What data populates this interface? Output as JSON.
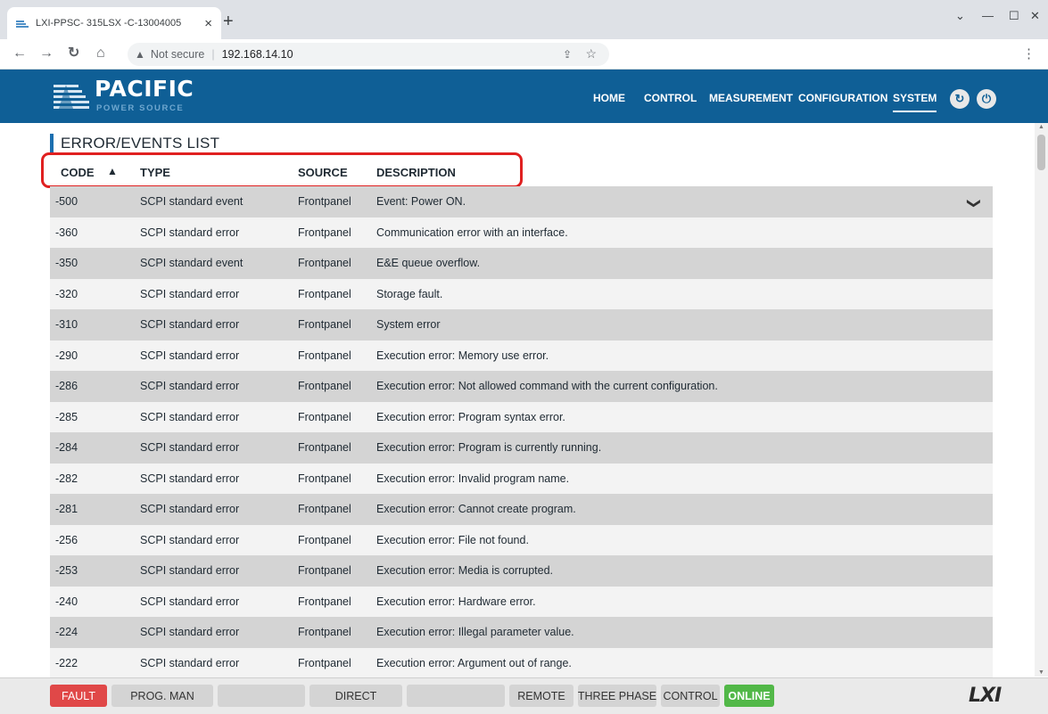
{
  "browser": {
    "tab_title": "LXI-PPSC- 315LSX -C-13004005",
    "address_security": "Not secure",
    "address_url": "192.168.14.10"
  },
  "header": {
    "brand": "PACIFIC",
    "brand_sub": "POWER SOURCE",
    "menu": [
      "HOME",
      "CONTROL",
      "MEASUREMENT",
      "CONFIGURATION",
      "SYSTEM"
    ],
    "active_menu": "SYSTEM",
    "accent_color": "#0f5f96"
  },
  "page": {
    "title": "ERROR/EVENTS LIST",
    "columns": {
      "code": "CODE",
      "type": "TYPE",
      "source": "SOURCE",
      "description": "DESCRIPTION"
    },
    "sort_column": "CODE",
    "rows": [
      {
        "code": "-500",
        "type": "SCPI standard event",
        "source": "Frontpanel",
        "description": "Event: Power ON."
      },
      {
        "code": "-360",
        "type": "SCPI standard error",
        "source": "Frontpanel",
        "description": "Communication error with an interface."
      },
      {
        "code": "-350",
        "type": "SCPI standard event",
        "source": "Frontpanel",
        "description": "E&E queue overflow."
      },
      {
        "code": "-320",
        "type": "SCPI standard error",
        "source": "Frontpanel",
        "description": "Storage fault."
      },
      {
        "code": "-310",
        "type": "SCPI standard error",
        "source": "Frontpanel",
        "description": "System error"
      },
      {
        "code": "-290",
        "type": "SCPI standard error",
        "source": "Frontpanel",
        "description": "Execution error: Memory use error."
      },
      {
        "code": "-286",
        "type": "SCPI standard error",
        "source": "Frontpanel",
        "description": "Execution error: Not allowed command with the current configuration."
      },
      {
        "code": "-285",
        "type": "SCPI standard error",
        "source": "Frontpanel",
        "description": "Execution error: Program syntax error."
      },
      {
        "code": "-284",
        "type": "SCPI standard error",
        "source": "Frontpanel",
        "description": "Execution error: Program is currently running."
      },
      {
        "code": "-282",
        "type": "SCPI standard error",
        "source": "Frontpanel",
        "description": "Execution error: Invalid program name."
      },
      {
        "code": "-281",
        "type": "SCPI standard error",
        "source": "Frontpanel",
        "description": "Execution error: Cannot create program."
      },
      {
        "code": "-256",
        "type": "SCPI standard error",
        "source": "Frontpanel",
        "description": "Execution error: File not found."
      },
      {
        "code": "-253",
        "type": "SCPI standard error",
        "source": "Frontpanel",
        "description": "Execution error: Media is corrupted."
      },
      {
        "code": "-240",
        "type": "SCPI standard error",
        "source": "Frontpanel",
        "description": "Execution error: Hardware error."
      },
      {
        "code": "-224",
        "type": "SCPI standard error",
        "source": "Frontpanel",
        "description": "Execution error: Illegal parameter value."
      },
      {
        "code": "-222",
        "type": "SCPI standard error",
        "source": "Frontpanel",
        "description": "Execution error: Argument out of range."
      }
    ]
  },
  "statusbar": {
    "fault": "FAULT",
    "prog": "PROG. MAN",
    "blank1": "",
    "direct": "DIRECT",
    "blank2": "",
    "remote": "REMOTE",
    "phase": "THREE PHASE",
    "control": "CONTROL",
    "online": "ONLINE",
    "logo": "LXI",
    "fault_color": "#e04848",
    "online_color": "#52b848"
  }
}
